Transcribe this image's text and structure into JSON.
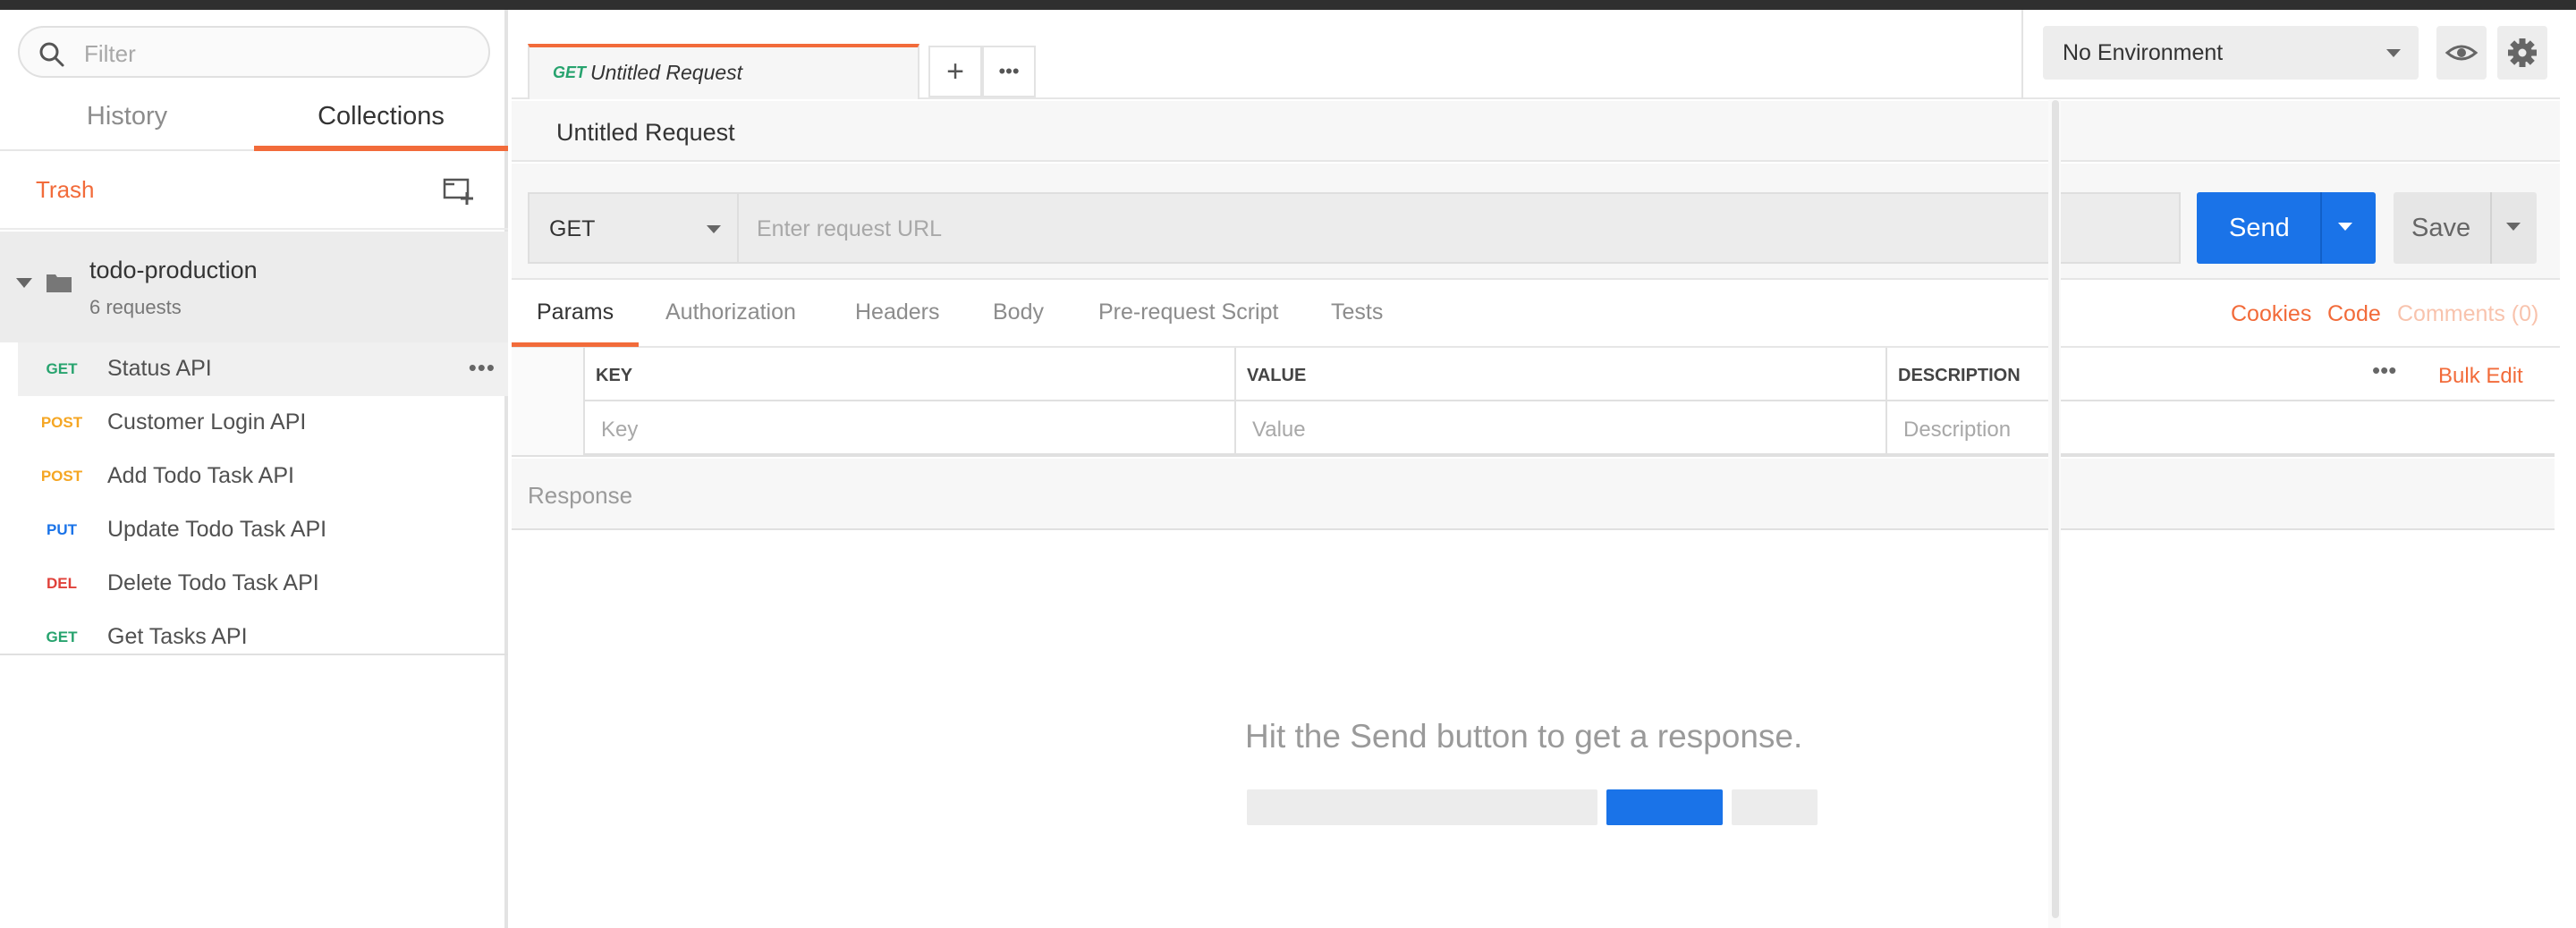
{
  "sidebar": {
    "filter_placeholder": "Filter",
    "tabs": {
      "history": "History",
      "collections": "Collections"
    },
    "trash": "Trash",
    "collection": {
      "name": "todo-production",
      "count": "6 requests"
    },
    "requests": [
      {
        "method": "GET",
        "name": "Status API",
        "color": "#27a36e"
      },
      {
        "method": "POST",
        "name": "Customer Login API",
        "color": "#f5a623"
      },
      {
        "method": "POST",
        "name": "Add Todo Task API",
        "color": "#f5a623"
      },
      {
        "method": "PUT",
        "name": "Update Todo Task API",
        "color": "#1a73e8"
      },
      {
        "method": "DEL",
        "name": "Delete Todo Task API",
        "color": "#e0413a"
      },
      {
        "method": "GET",
        "name": "Get Tasks API",
        "color": "#27a36e"
      }
    ]
  },
  "tabbar": {
    "request_tab": {
      "method": "GET",
      "title": "Untitled Request"
    },
    "add_label": "+",
    "more_label": "•••",
    "environment": "No Environment"
  },
  "request": {
    "title": "Untitled Request",
    "method": "GET",
    "url_placeholder": "Enter request URL",
    "send_label": "Send",
    "save_label": "Save"
  },
  "subtabs": {
    "items": [
      "Params",
      "Authorization",
      "Headers",
      "Body",
      "Pre-request Script",
      "Tests"
    ],
    "active": "Params",
    "right_links": {
      "cookies": "Cookies",
      "code": "Code",
      "comments": "Comments (0)"
    }
  },
  "params": {
    "headers": {
      "key": "KEY",
      "value": "VALUE",
      "description": "DESCRIPTION"
    },
    "placeholders": {
      "key": "Key",
      "value": "Value",
      "description": "Description"
    },
    "bulk_more": "•••",
    "bulk_edit": "Bulk Edit"
  },
  "response": {
    "title": "Response",
    "empty_message": "Hit the Send button to get a response."
  },
  "colors": {
    "accent": "#f26b3a",
    "primary": "#1a73e8",
    "get": "#27a36e",
    "post": "#f5a623",
    "put": "#1a73e8",
    "del": "#e0413a"
  }
}
